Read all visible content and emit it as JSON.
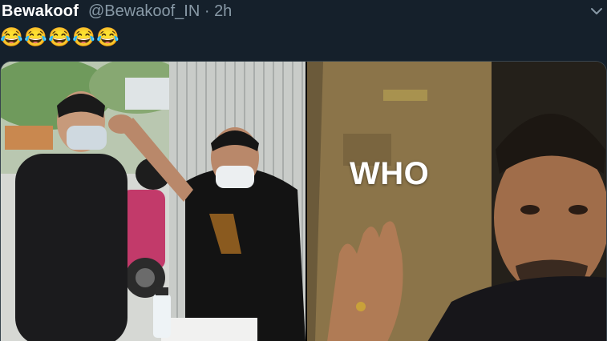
{
  "tweet": {
    "display_name": "Bewakoof",
    "handle": "@Bewakoof_IN",
    "separator": "·",
    "timestamp": "2h",
    "text_emojis": [
      "😂",
      "😂",
      "😂",
      "😂",
      "😂"
    ],
    "more_icon": "chevron-down-icon"
  },
  "media": {
    "left_panel": "photo-two-men-temperature-check",
    "right_panel": {
      "caption": "WHO"
    }
  },
  "colors": {
    "background": "#15202b",
    "secondary_text": "#8899a6",
    "border": "#38444d"
  }
}
